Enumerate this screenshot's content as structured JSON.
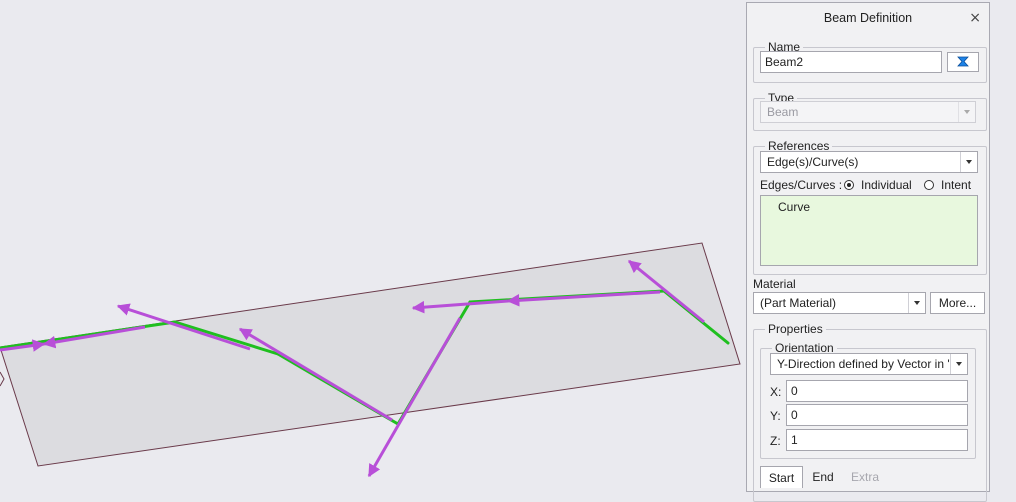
{
  "dialog": {
    "title": "Beam Definition",
    "close_label": "×"
  },
  "name_group": {
    "legend": "Name",
    "value": "Beam2",
    "icon": "swap-color-icon"
  },
  "type_group": {
    "legend": "Type",
    "selected": "Beam"
  },
  "references_group": {
    "legend": "References",
    "selected": "Edge(s)/Curve(s)",
    "edges_label": "Edges/Curves :",
    "radio_individual": "Individual",
    "radio_intent": "Intent",
    "selected_radio": "Individual",
    "collector_items": [
      "Curve"
    ]
  },
  "material": {
    "label": "Material",
    "selected": "(Part Material)",
    "more_button": "More..."
  },
  "properties_group": {
    "legend": "Properties",
    "orientation": {
      "legend": "Orientation",
      "selected": "Y-Direction defined by Vector in '",
      "x_label": "X:",
      "x_value": "0",
      "y_label": "Y:",
      "y_value": "0",
      "z_label": "Z:",
      "z_value": "1"
    }
  },
  "tabs": [
    "Start",
    "End",
    "Extra"
  ],
  "active_tab": "Start",
  "colors": {
    "beam_green": "#1fbf1f",
    "vector_magenta": "#b84fd8",
    "surface_fill": "#dcdce0",
    "surface_edge": "#6a3a4a",
    "collector_bg": "#e8f8de"
  }
}
